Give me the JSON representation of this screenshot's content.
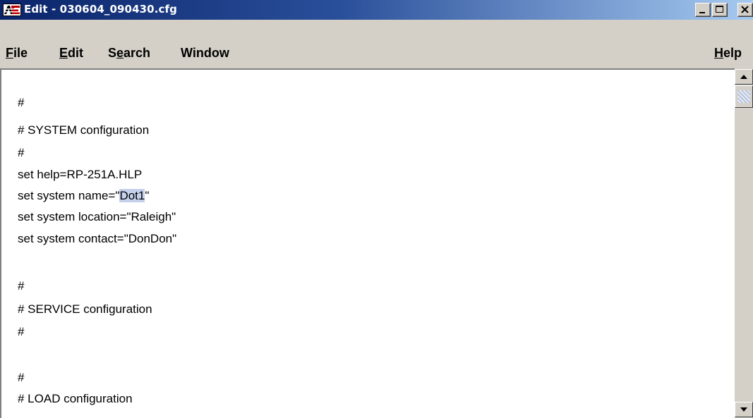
{
  "window": {
    "title": "Edit - 030604_090430.cfg",
    "app_icon": "ae-logo-icon",
    "controls": {
      "minimize": "minimize-icon",
      "maximize": "maximize-icon",
      "close": "close-icon"
    }
  },
  "menu": {
    "file": {
      "mnemonic": "F",
      "rest": "ile"
    },
    "edit": {
      "mnemonic": "E",
      "rest": "dit"
    },
    "search": {
      "before": "S",
      "mnemonic": "e",
      "rest": "arch"
    },
    "window": {
      "label": "Window"
    },
    "help": {
      "mnemonic": "H",
      "rest": "elp"
    }
  },
  "editor": {
    "lines": [
      "",
      "#",
      "# SYSTEM configuration",
      "#",
      "set help=RP-251A.HLP",
      "set system name=\"",
      "set system location=\"Raleigh\"",
      "set system contact=\"DonDon\"",
      "",
      "#",
      "# SERVICE configuration",
      "#",
      "",
      "#",
      "# LOAD configuration"
    ],
    "selected_text": "Dot1",
    "after_selection": "\""
  },
  "colors": {
    "titlebar_start": "#0a246a",
    "titlebar_end": "#a6caf0",
    "selection": "#c4d0ec",
    "chrome": "#d4d0c8"
  }
}
